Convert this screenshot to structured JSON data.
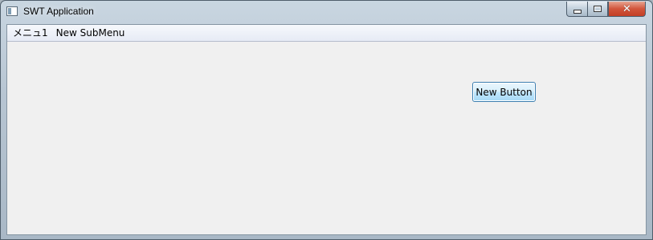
{
  "window": {
    "title": "SWT Application",
    "controls": {
      "minimize_icon": "minimize-icon",
      "maximize_icon": "maximize-icon",
      "close_icon": "close-icon",
      "close_glyph": "✕"
    }
  },
  "menubar": {
    "items": [
      {
        "label": "メニュ1"
      },
      {
        "label": "New SubMenu"
      }
    ]
  },
  "main": {
    "button_label": "New Button"
  },
  "colors": {
    "client_background": "#f0f0f0",
    "menubar_background": "#e6ebf5",
    "button_border": "#3c7fb1",
    "close_button": "#c33f25"
  }
}
